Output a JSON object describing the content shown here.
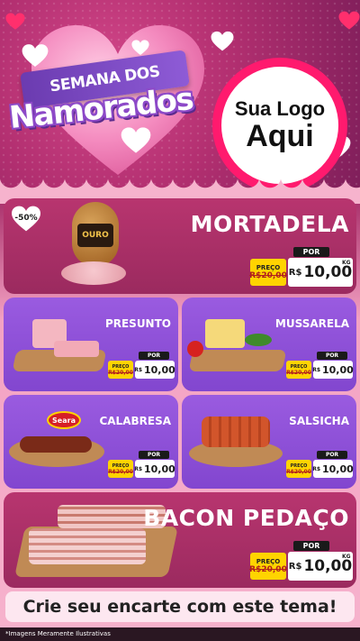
{
  "header": {
    "banner": "SEMANA DOS",
    "title": "Namorados",
    "logo_line1": "Sua Logo",
    "logo_line2": "Aqui"
  },
  "products": {
    "mortadela": {
      "name": "MORTADELA",
      "discount": "-50%",
      "por": "POR",
      "preco": "PREÇO",
      "old": "R$20,00",
      "currency": "R$",
      "price": "10,00",
      "unit": "KG"
    },
    "presunto": {
      "name": "PRESUNTO",
      "por": "POR",
      "preco": "PREÇO",
      "old": "R$20,00",
      "currency": "R$",
      "price": "10,00"
    },
    "mussarela": {
      "name": "MUSSARELA",
      "por": "POR",
      "preco": "PREÇO",
      "old": "R$20,00",
      "currency": "R$",
      "price": "10,00"
    },
    "calabresa": {
      "name": "CALABRESA",
      "brand": "Seara",
      "por": "POR",
      "preco": "PREÇO",
      "old": "R$20,00",
      "currency": "R$",
      "price": "10,00"
    },
    "salsicha": {
      "name": "SALSICHA",
      "por": "POR",
      "preco": "PREÇO",
      "old": "R$20,00",
      "currency": "R$",
      "price": "10,00"
    },
    "bacon": {
      "name": "BACON PEDAÇO",
      "por": "POR",
      "preco": "PREÇO",
      "old": "R$20,00",
      "currency": "R$",
      "price": "10,00",
      "unit": "KG"
    }
  },
  "mortadela_label": "OURO",
  "cta": "Crie seu encarte com este tema!",
  "disclaimer": "*Imagens Meramente Ilustrativas",
  "colors": {
    "pink": "#b8356f",
    "purple": "#8e52d8",
    "yellow": "#ffd400",
    "logo_ring": "#ff1a6e"
  }
}
